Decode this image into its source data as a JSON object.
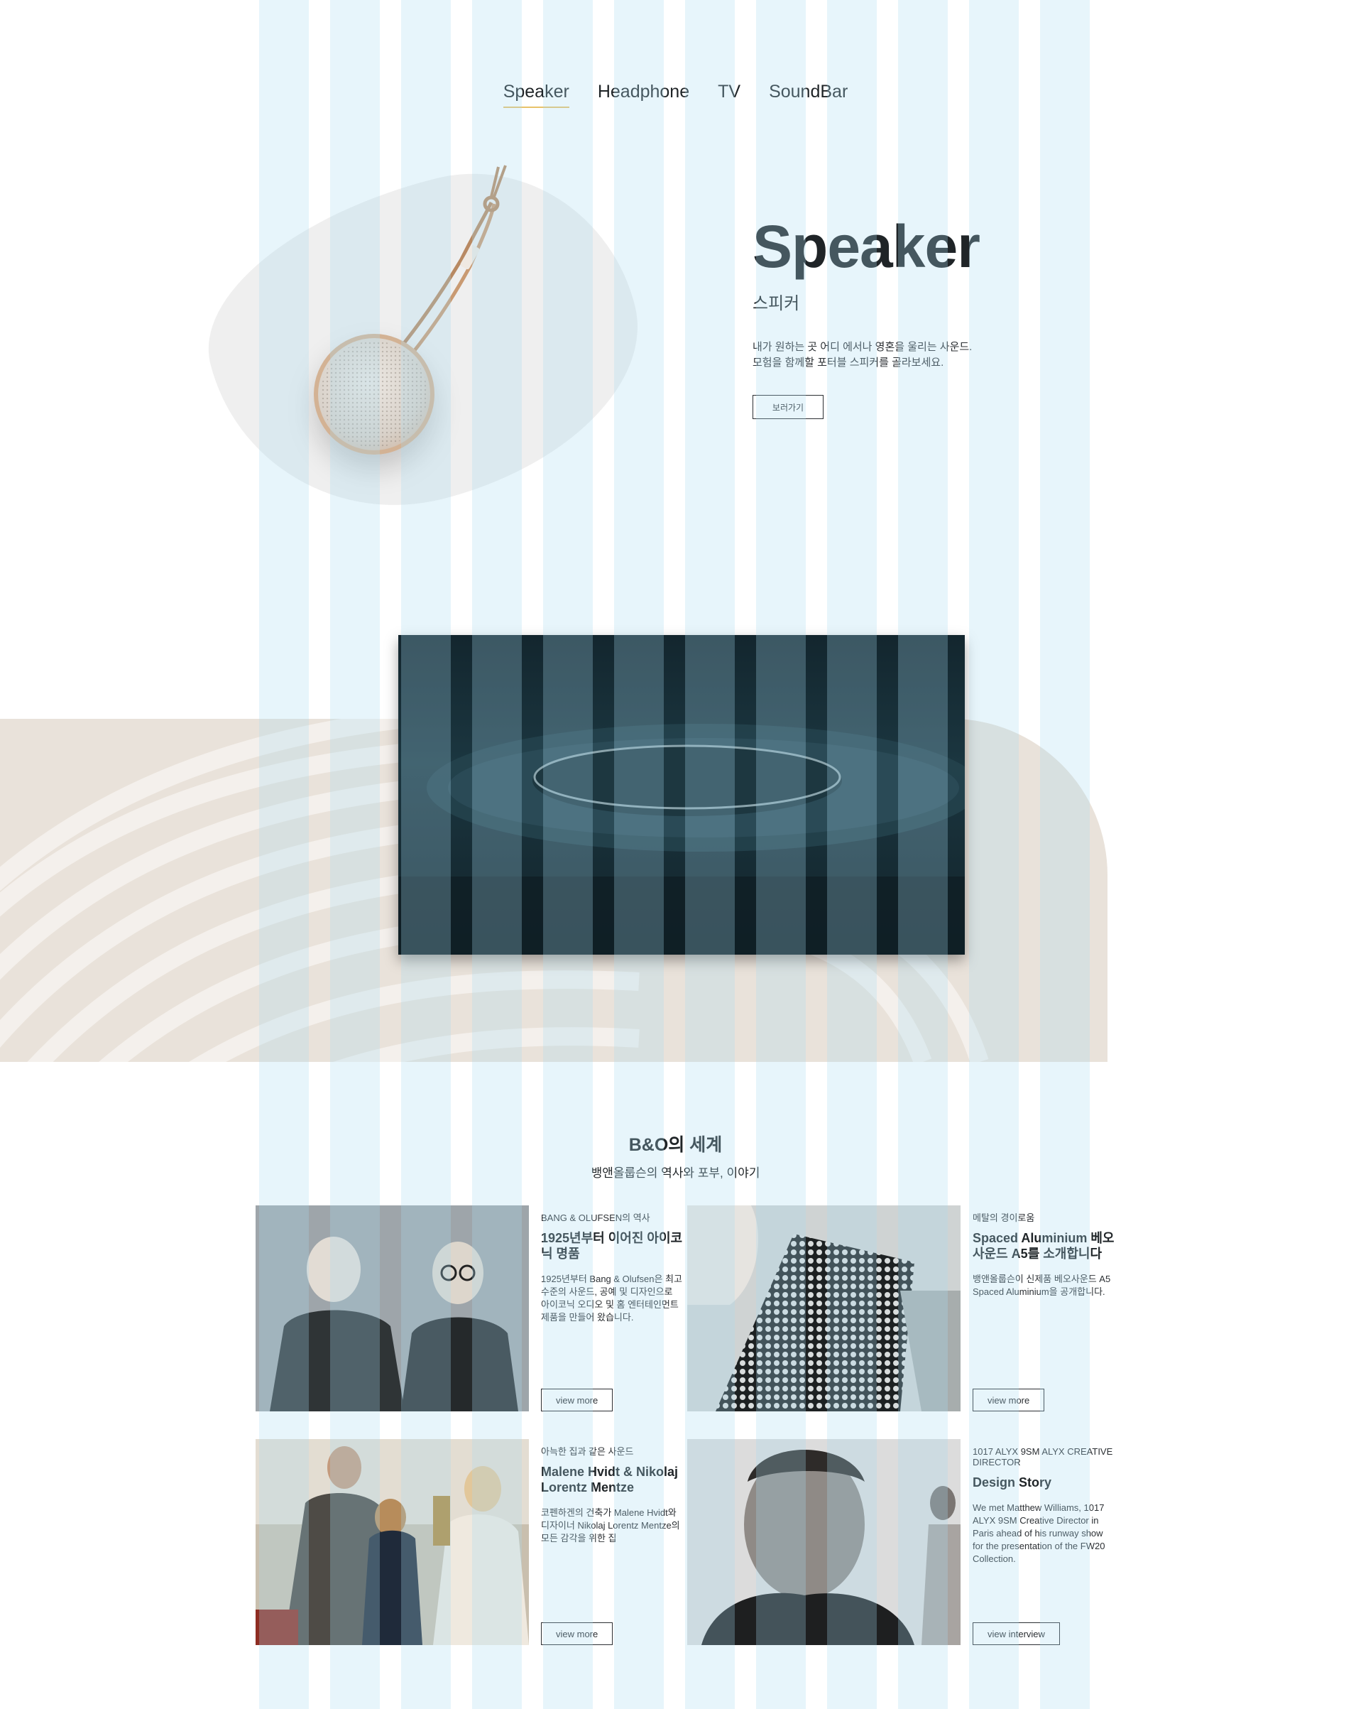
{
  "nav": {
    "items": [
      {
        "label": "Speaker",
        "active": true
      },
      {
        "label": "Headphone",
        "active": false
      },
      {
        "label": "TV",
        "active": false
      },
      {
        "label": "SoundBar",
        "active": false
      }
    ],
    "accent": "#e8c26a"
  },
  "hero": {
    "title": "Speaker",
    "subtitle": "스피커",
    "desc_line1": "내가 원하는 곳 어디 에서나 영혼을 울리는 사운드.",
    "desc_line2": "모험을 함께할 포터블 스피커를 골라보세요.",
    "button": "보러가기"
  },
  "world": {
    "title": "B&O의 세계",
    "subtitle": "뱅앤올룹슨의 역사와 포부, 이야기"
  },
  "cards": [
    {
      "kicker": "BANG & OLUFSEN의 역사",
      "title": "1925년부터 이어진 아이코닉 명품",
      "desc": "1925년부터 Bang & Olufsen은 최고 수준의 사운드, 공예 및 디자인으로 아이코닉 오디오 및 홈 엔터테인먼트 제품을 만들어 왔습니다.",
      "button": "view more"
    },
    {
      "kicker": "메탈의 경이로움",
      "title": "Spaced Aluminium 베오사운드 A5를 소개합니다",
      "desc": "뱅앤올룹슨이 신제품 베오사운드 A5 Spaced Aluminium을 공개합니다.",
      "button": "view more"
    },
    {
      "kicker": "아늑한 집과 같은 사운드",
      "title": "Malene Hvidt & Nikolaj Lorentz Mentze",
      "desc": "코펜하겐의 건축가 Malene Hvidt와 디자이너 Nikolaj Lorentz Mentze의모든 감각을 위한 집",
      "button": "view more"
    },
    {
      "kicker": "1017 ALYX 9SM ALYX CREATIVE DIRECTOR",
      "title": "Design Story",
      "desc": "We met Matthew Williams, 1017 ALYX 9SM Creative Director in Paris ahead of his runway show for the presentation of the FW20 Collection.",
      "button": "view interview"
    }
  ],
  "colors": {
    "text": "#1f2427",
    "grid_overlay": "#a8dcf0",
    "video_dark": "#13262e",
    "sand": "#e9e2da"
  }
}
